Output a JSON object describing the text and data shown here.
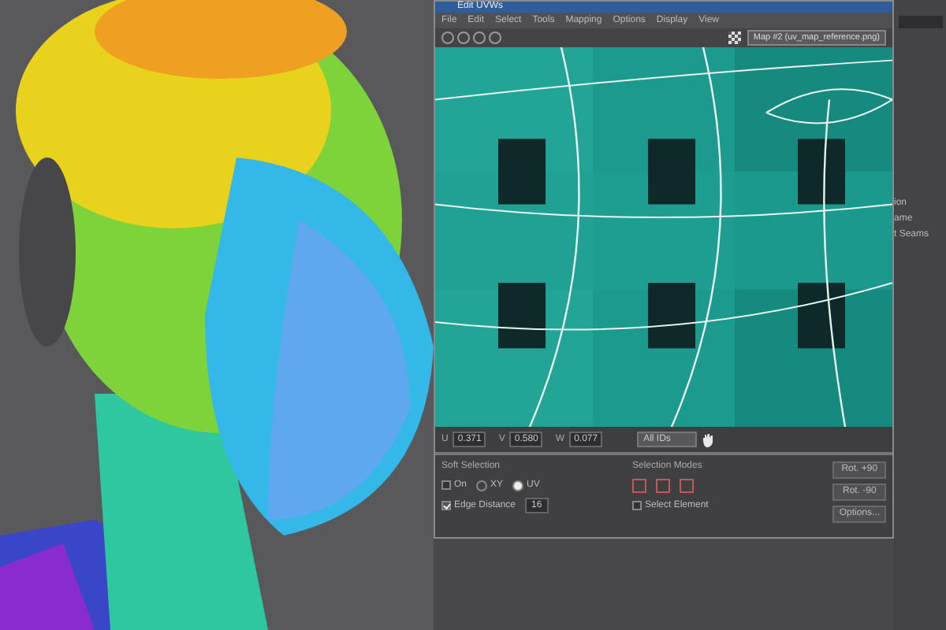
{
  "editor": {
    "title": "Edit UVWs",
    "menu": [
      "File",
      "Edit",
      "Select",
      "Tools",
      "Mapping",
      "Options",
      "Display",
      "View"
    ],
    "map_select": "Map #2 (uv_map_reference.png)",
    "coords": [
      {
        "label": "U",
        "value": "0.371"
      },
      {
        "label": "V",
        "value": "0.580"
      },
      {
        "label": "W",
        "value": "0.077"
      }
    ],
    "id_filter": "All IDs",
    "soft_selection": {
      "title": "Soft Selection",
      "on": {
        "label": "On",
        "checked": false
      },
      "spaces": [
        {
          "label": "XY",
          "selected": false
        },
        {
          "label": "UV",
          "selected": true
        }
      ],
      "edge_distance": {
        "label": "Edge Distance",
        "checked": true,
        "value": "16"
      }
    },
    "selection_modes": {
      "title": "Selection Modes",
      "select_element": {
        "label": "Select Element",
        "checked": false
      }
    },
    "buttons": [
      "Rot. +90",
      "Rot. -90",
      "Options..."
    ]
  },
  "side_panel": {
    "items": [
      "ion",
      "ame",
      "t Seams"
    ]
  }
}
